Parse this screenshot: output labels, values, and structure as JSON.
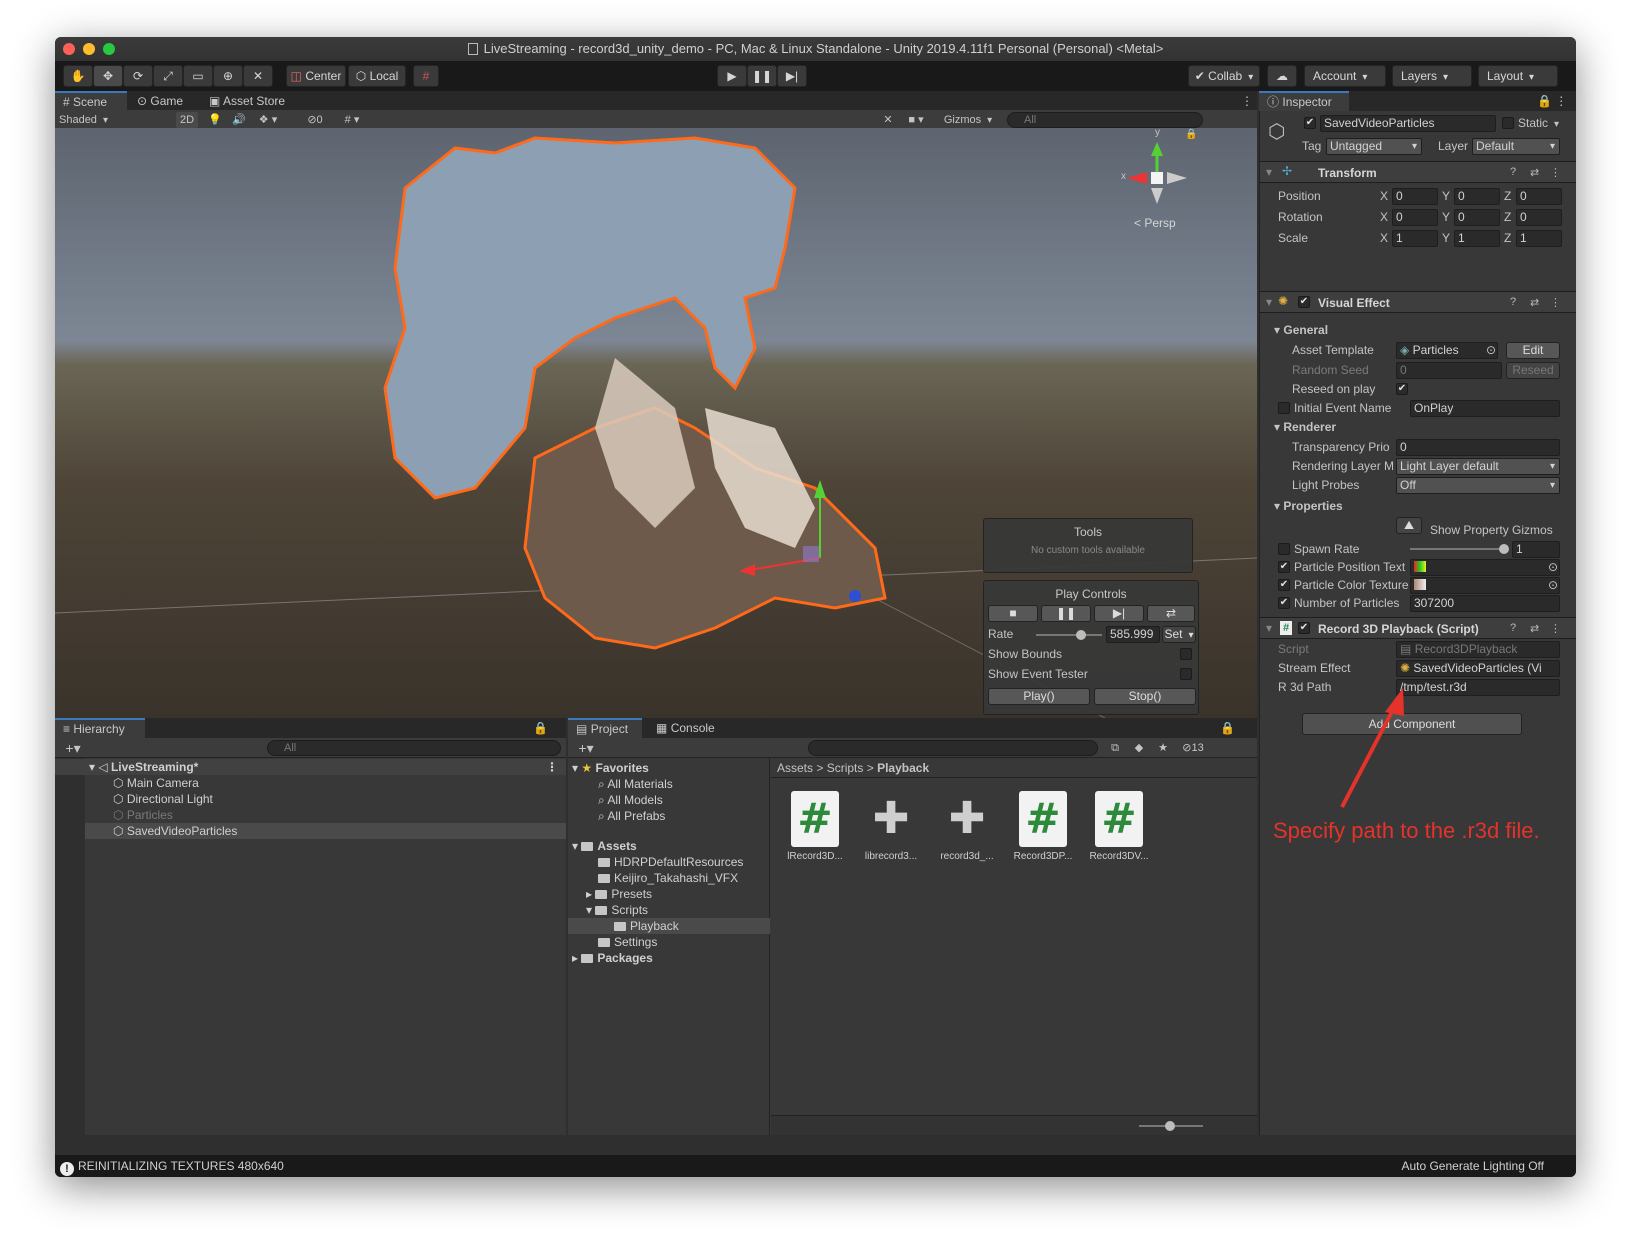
{
  "window": {
    "title": "LiveStreaming - record3d_unity_demo - PC, Mac & Linux Standalone - Unity 2019.4.11f1 Personal (Personal) <Metal>"
  },
  "toolbar": {
    "pivot_center": "Center",
    "pivot_local": "Local",
    "collab": "Collab",
    "account": "Account",
    "layers": "Layers",
    "layout": "Layout"
  },
  "scene_panel": {
    "tabs": [
      "Scene",
      "Game",
      "Asset Store"
    ],
    "shading_mode": "Shaded",
    "mode_2d": "2D",
    "hidden_count": "0",
    "gizmos": "Gizmos",
    "search_placeholder": "All",
    "persp_label": "< Persp",
    "gizmo_x": "x",
    "gizmo_y": "y"
  },
  "tools_overlay": {
    "title": "Tools",
    "subtitle": "No custom tools available"
  },
  "play_controls": {
    "title": "Play Controls",
    "rate_label": "Rate",
    "rate_value": "585.999",
    "set_label": "Set",
    "rate_fraction": 0.68,
    "show_bounds": "Show Bounds",
    "show_event_tester": "Show Event Tester",
    "play_button": "Play()",
    "stop_button": "Stop()"
  },
  "hierarchy": {
    "tab": "Hierarchy",
    "search_placeholder": "All",
    "scene_name": "LiveStreaming*",
    "items": [
      "Main Camera",
      "Directional Light",
      "Particles",
      "SavedVideoParticles"
    ]
  },
  "project": {
    "tabs": [
      "Project",
      "Console"
    ],
    "hidden_count": "13",
    "favorites_label": "Favorites",
    "favorites": [
      "All Materials",
      "All Models",
      "All Prefabs"
    ],
    "assets_label": "Assets",
    "assets_children": [
      "HDRPDefaultResources",
      "Keijiro_Takahashi_VFX",
      "Presets",
      "Scripts",
      "Playback",
      "Settings"
    ],
    "packages_label": "Packages",
    "breadcrumb": [
      "Assets",
      "Scripts",
      "Playback"
    ],
    "asset_items": [
      "lRecord3D...",
      "librecord3...",
      "record3d_...",
      "Record3DP...",
      "Record3DV..."
    ]
  },
  "inspector": {
    "tab": "Inspector",
    "object_name": "SavedVideoParticles",
    "static_label": "Static",
    "tag_label": "Tag",
    "tag_value": "Untagged",
    "layer_label": "Layer",
    "layer_value": "Default",
    "transform": {
      "title": "Transform",
      "rows": [
        {
          "label": "Position",
          "x": "0",
          "y": "0",
          "z": "0"
        },
        {
          "label": "Rotation",
          "x": "0",
          "y": "0",
          "z": "0"
        },
        {
          "label": "Scale",
          "x": "1",
          "y": "1",
          "z": "1"
        }
      ],
      "axis_x": "X",
      "axis_y": "Y",
      "axis_z": "Z"
    },
    "visual_effect": {
      "title": "Visual Effect",
      "general": "General",
      "asset_template_label": "Asset Template",
      "asset_template_value": "Particles",
      "edit_button": "Edit",
      "random_seed_label": "Random Seed",
      "random_seed_value": "0",
      "reseed_button": "Reseed",
      "reseed_on_play_label": "Reseed on play",
      "initial_event_label": "Initial Event Name",
      "initial_event_value": "OnPlay",
      "renderer": "Renderer",
      "transparency_label": "Transparency Prio",
      "transparency_value": "0",
      "rendering_layer_label": "Rendering Layer M",
      "rendering_layer_value": "Light Layer default",
      "light_probes_label": "Light Probes",
      "light_probes_value": "Off",
      "properties": "Properties",
      "show_gizmos": "Show Property Gizmos",
      "spawn_rate_label": "Spawn Rate",
      "spawn_rate_value": "1",
      "spawn_rate_fraction": 1.0,
      "particle_position_label": "Particle Position Text",
      "particle_color_label": "Particle Color Texture",
      "num_particles_label": "Number of Particles",
      "num_particles_value": "307200"
    },
    "playback_script": {
      "title": "Record 3D Playback (Script)",
      "script_label": "Script",
      "script_value": "Record3DPlayback",
      "stream_effect_label": "Stream Effect",
      "stream_effect_value": "SavedVideoParticles (Vi",
      "r3d_path_label": "R 3d Path",
      "r3d_path_value": "/tmp/test.r3d"
    },
    "add_component": "Add Component"
  },
  "annotation": "Specify path to the .r3d file.",
  "status": {
    "message": "REINITIALIZING TEXTURES 480x640",
    "lighting": "Auto Generate Lighting Off"
  },
  "colors": {
    "accent": "#3a79bb",
    "particle_outline": "#ff6a1a",
    "annotation": "#e5322b"
  }
}
